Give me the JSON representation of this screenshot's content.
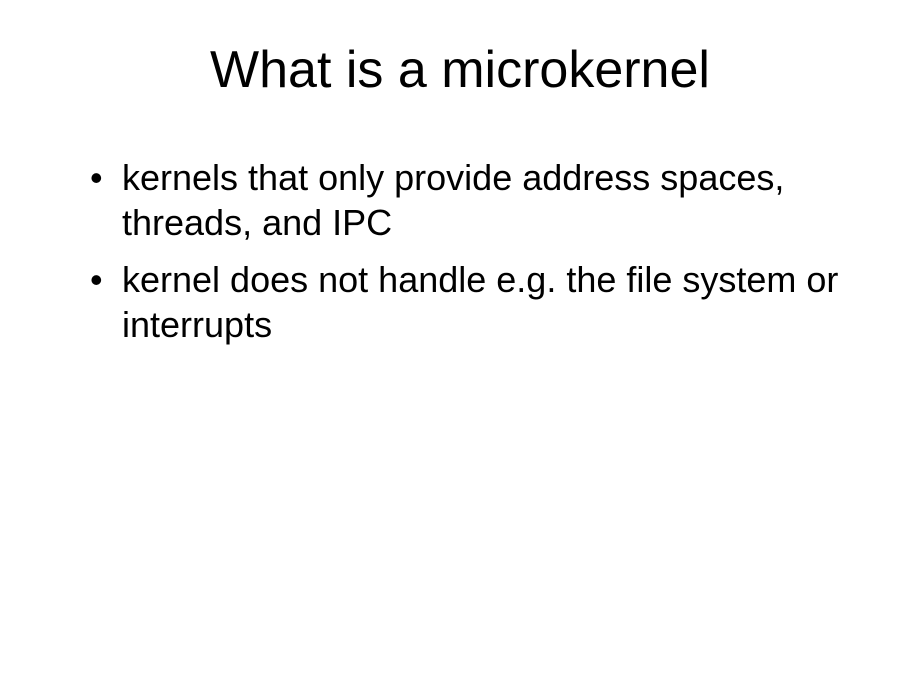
{
  "slide": {
    "title": "What is a microkernel",
    "bullets": [
      "kernels that only provide address spaces, threads, and IPC",
      "kernel does not handle e.g. the file system or interrupts"
    ]
  }
}
